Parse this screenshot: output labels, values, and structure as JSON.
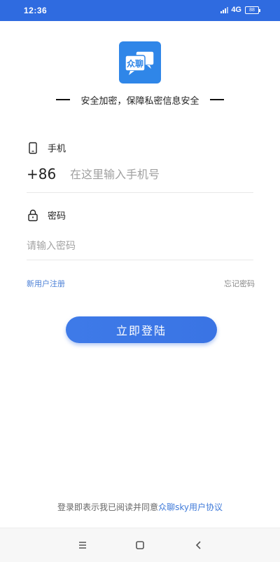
{
  "status_bar": {
    "time": "12:36",
    "network": "4G",
    "battery": "88"
  },
  "logo": {
    "text": "众聊",
    "color": "#2f86e8"
  },
  "slogan": "安全加密，保障私密信息安全",
  "phone": {
    "label": "手机",
    "country_code": "+86",
    "placeholder": "在这里输入手机号",
    "icon": "phone-icon"
  },
  "password": {
    "label": "密码",
    "placeholder": "请输入密码",
    "icon": "lock-icon"
  },
  "links": {
    "register": "新用户注册",
    "forgot": "忘记密码"
  },
  "login_button": "立即登陆",
  "agreement": {
    "text": "登录即表示我已阅读并同意",
    "link": "众聊sky用户协议"
  },
  "nav_bar": {
    "icons": [
      "menu-icon",
      "home-icon",
      "back-icon"
    ]
  },
  "colors": {
    "primary": "#2f6be0",
    "link": "#4a7fd6",
    "button": "#3e7ae8"
  }
}
